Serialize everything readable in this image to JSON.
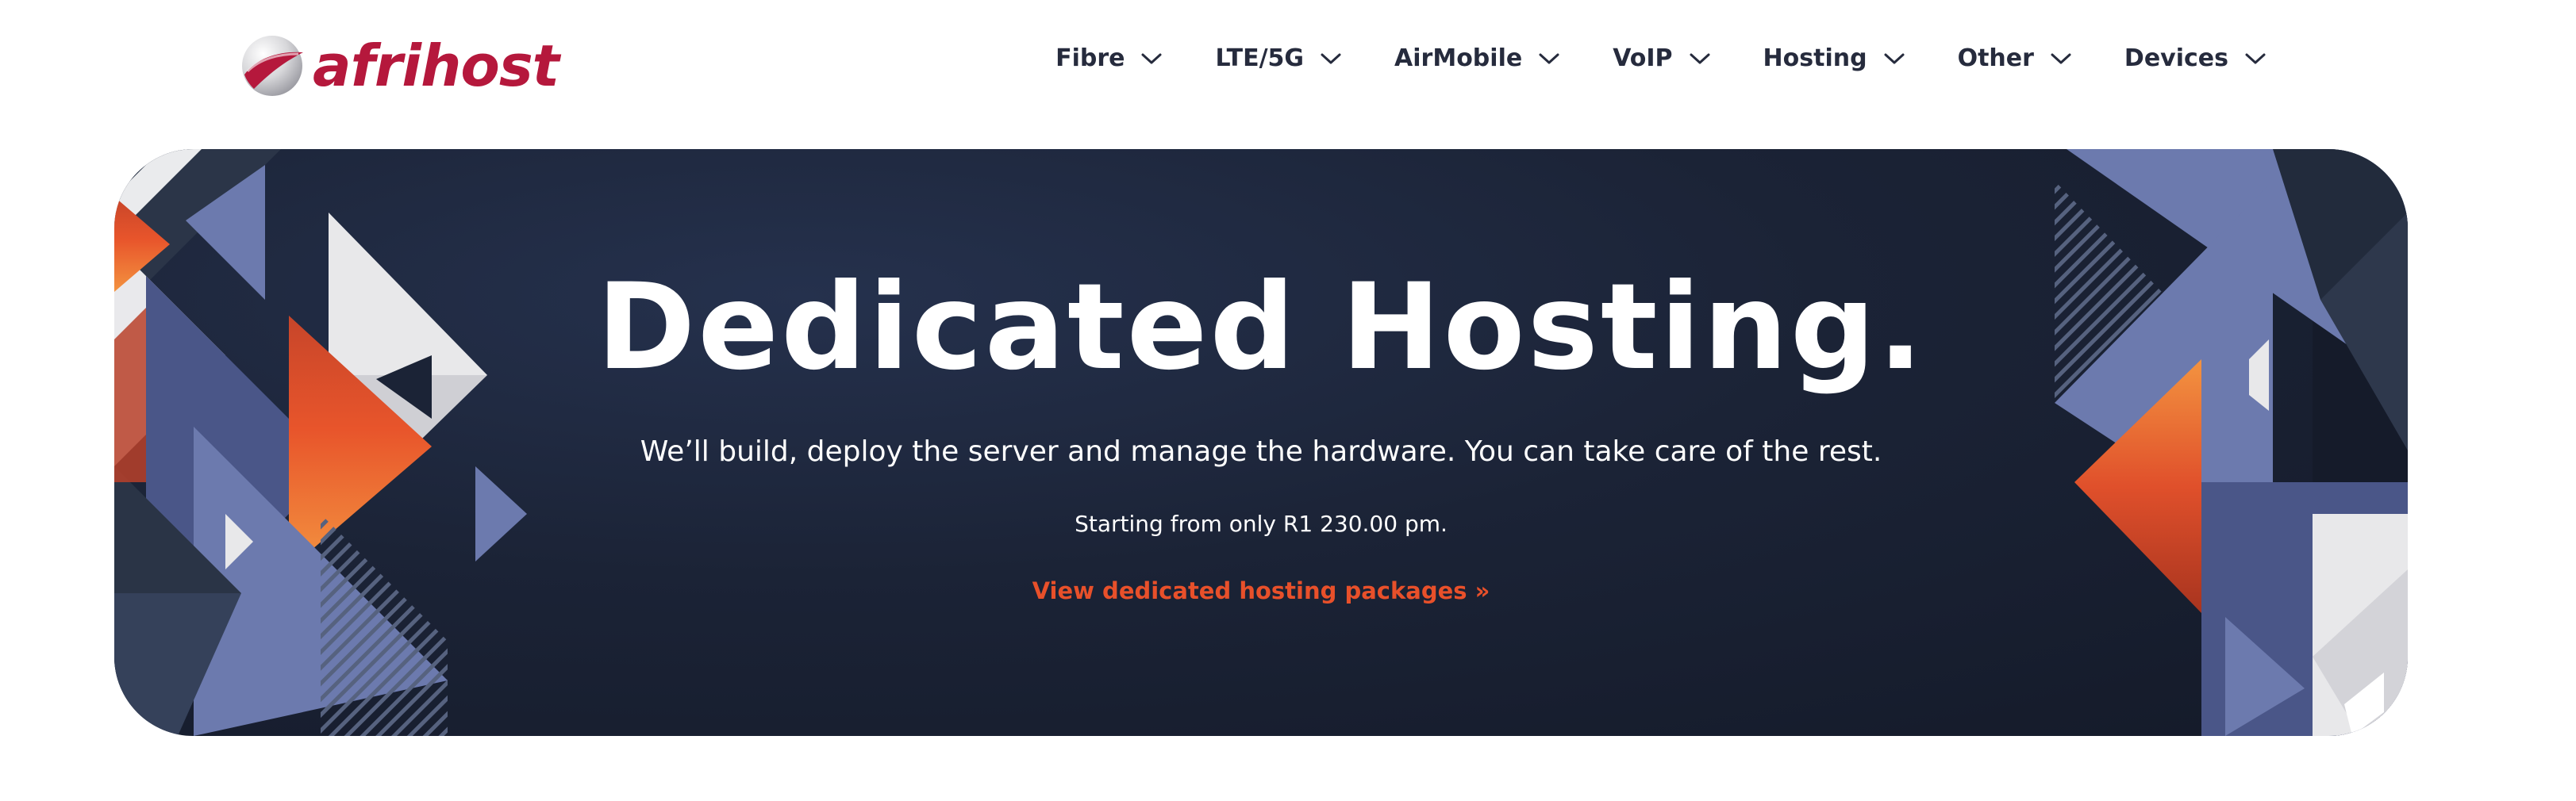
{
  "brand": {
    "name": "afrihost",
    "color": "#b5183c",
    "logo_icon": "afrihost-globe-icon"
  },
  "nav": {
    "items": [
      {
        "label": "Fibre",
        "icon": "chevron-down-icon"
      },
      {
        "label": "LTE/5G",
        "icon": "chevron-down-icon"
      },
      {
        "label": "AirMobile",
        "icon": "chevron-down-icon"
      },
      {
        "label": "VoIP",
        "icon": "chevron-down-icon"
      },
      {
        "label": "Hosting",
        "icon": "chevron-down-icon"
      },
      {
        "label": "Other",
        "icon": "chevron-down-icon"
      },
      {
        "label": "Devices",
        "icon": "chevron-down-icon"
      }
    ],
    "text_color": "#262b3d"
  },
  "hero": {
    "title": "Dedicated Hosting.",
    "subtitle": "We’ll build, deploy the server and manage the hardware. You can take care of the rest.",
    "price_text": "Starting from only R1 230.00 pm.",
    "link_label": "View dedicated hosting packages »",
    "link_color": "#e8502a",
    "background": "#1b2336",
    "art_colors": {
      "slate": "#6c7aae",
      "slate_dark": "#4a5688",
      "orange": "#f18a3a",
      "orange_dark": "#c7452a",
      "light_gray": "#e8e8ea",
      "dark_gray": "#2a3446"
    }
  }
}
